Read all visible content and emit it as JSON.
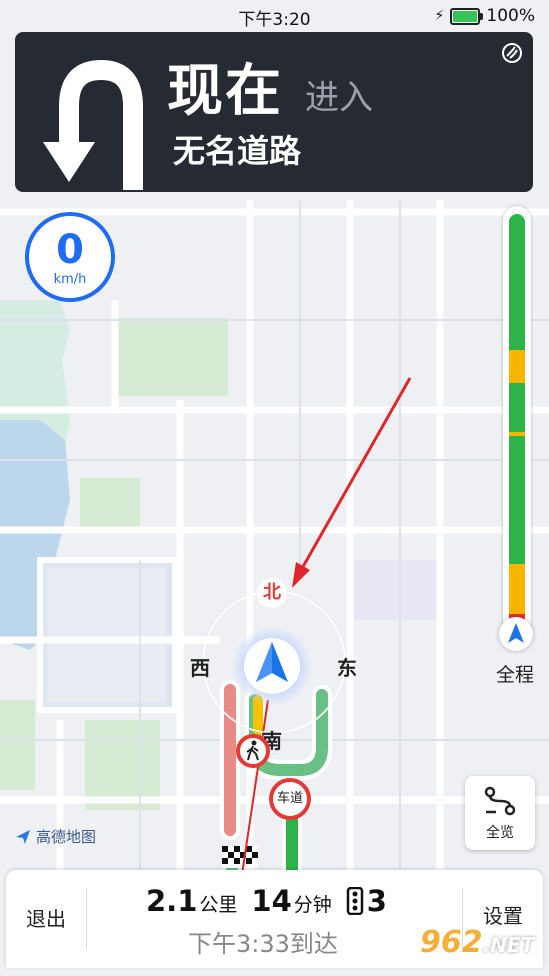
{
  "status_bar": {
    "time": "下午3:20",
    "battery": "100%",
    "battery_level": 1.0
  },
  "guidance": {
    "distance": "现在",
    "action": "进入",
    "road": "无名道路",
    "icon": "u-turn-left-icon"
  },
  "speed": {
    "value": "0",
    "unit": "km/h"
  },
  "traffic": {
    "label": "全程",
    "segments": [
      {
        "status": "smooth",
        "fraction": 0.33,
        "color": "#2db34a"
      },
      {
        "status": "slow",
        "fraction": 0.08,
        "color": "#f7b500"
      },
      {
        "status": "smooth",
        "fraction": 0.12,
        "color": "#2db34a"
      },
      {
        "status": "slow",
        "fraction": 0.01,
        "color": "#f7b500"
      },
      {
        "status": "smooth",
        "fraction": 0.31,
        "color": "#2db34a"
      },
      {
        "status": "slow",
        "fraction": 0.12,
        "color": "#f7b500"
      },
      {
        "status": "congested",
        "fraction": 0.03,
        "color": "#e8322d"
      }
    ]
  },
  "overview_button": {
    "label": "全览"
  },
  "compass": {
    "north": "北",
    "west": "西",
    "east": "东",
    "south": "南"
  },
  "road_signs": {
    "lane_sign": "车道"
  },
  "brand": {
    "name": "高德地图"
  },
  "trip": {
    "exit": "退出",
    "settings": "设置",
    "distance": "2.1",
    "distance_unit": "公里",
    "duration": "14",
    "duration_unit": "分钟",
    "lights": "3",
    "eta": "下午3:33到达"
  },
  "watermark": {
    "brand": "962",
    "suffix": ".NET"
  }
}
